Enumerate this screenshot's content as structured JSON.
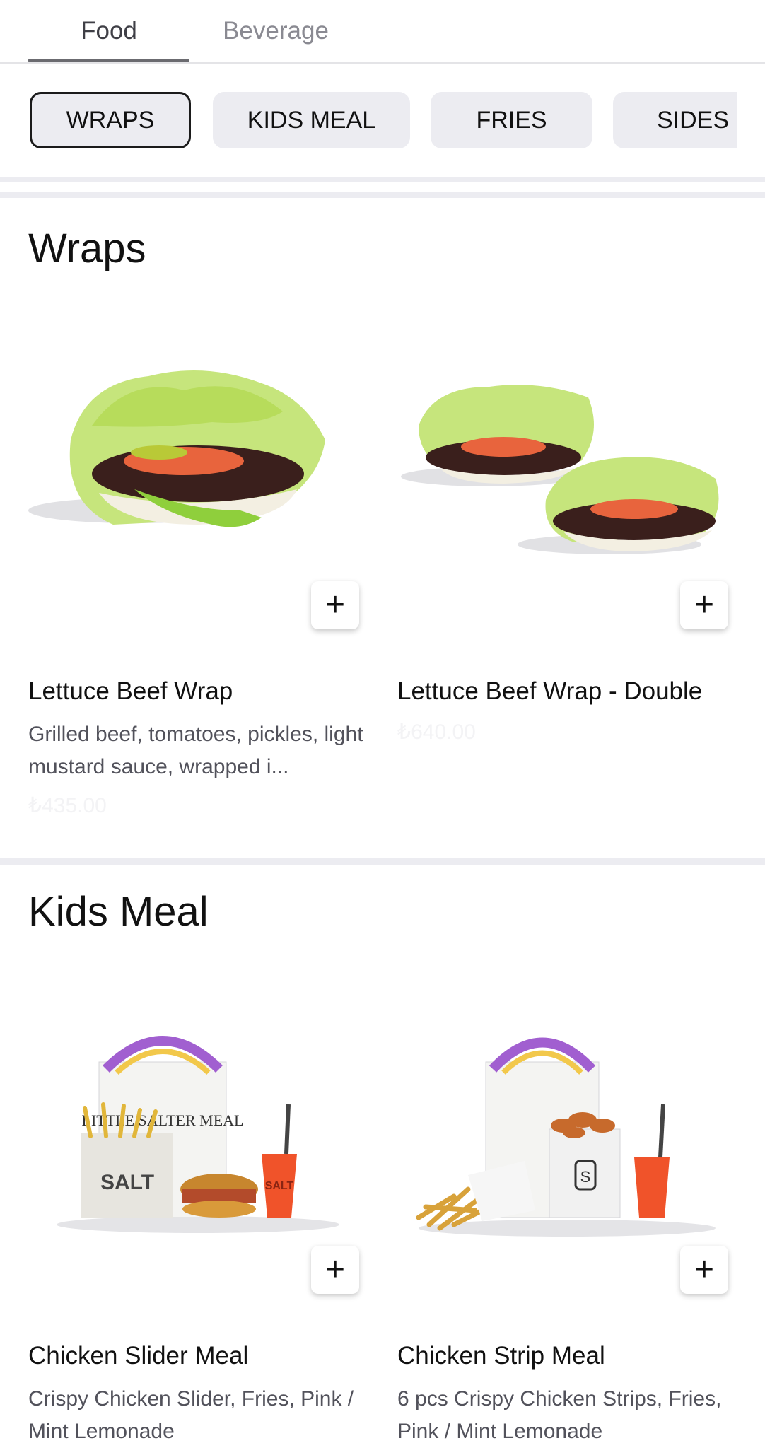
{
  "tabs": [
    {
      "label": "Food",
      "active": true
    },
    {
      "label": "Beverage",
      "active": false
    }
  ],
  "categories": [
    {
      "label": "WRAPS",
      "active": true
    },
    {
      "label": "KIDS MEAL",
      "active": false
    },
    {
      "label": "FRIES",
      "active": false
    },
    {
      "label": "SIDES",
      "active": false
    }
  ],
  "sections": [
    {
      "title": "Wraps",
      "items": [
        {
          "name": "Lettuce Beef Wrap",
          "description": "Grilled beef, tomatoes, pickles, light mustard sauce, wrapped i...",
          "price": "₺435.00"
        },
        {
          "name": "Lettuce Beef Wrap - Double",
          "description": "",
          "price": "₺640.00"
        }
      ]
    },
    {
      "title": "Kids Meal",
      "items": [
        {
          "name": "Chicken Slider Meal",
          "description": "Crispy Chicken Slider, Fries, Pink / Mint Lemonade",
          "price": ""
        },
        {
          "name": "Chicken Strip Meal",
          "description": "6 pcs Crispy Chicken Strips, Fries, Pink / Mint Lemonade",
          "price": ""
        }
      ]
    }
  ],
  "add_label": "+",
  "image_text": {
    "box_brand": "LITTLE SALTER MEAL",
    "bag_brand": "SALT",
    "cup_brand": "SALT",
    "shaker_letter": "S"
  },
  "colors": {
    "chip_bg": "#ececf1",
    "chip_active_border": "#1b1b1b",
    "lettuce": "#b7dc5b",
    "tomato": "#e8643d",
    "patty": "#3a1f1c",
    "drink": "#f0532a",
    "box_arch": "#a15fd0"
  }
}
